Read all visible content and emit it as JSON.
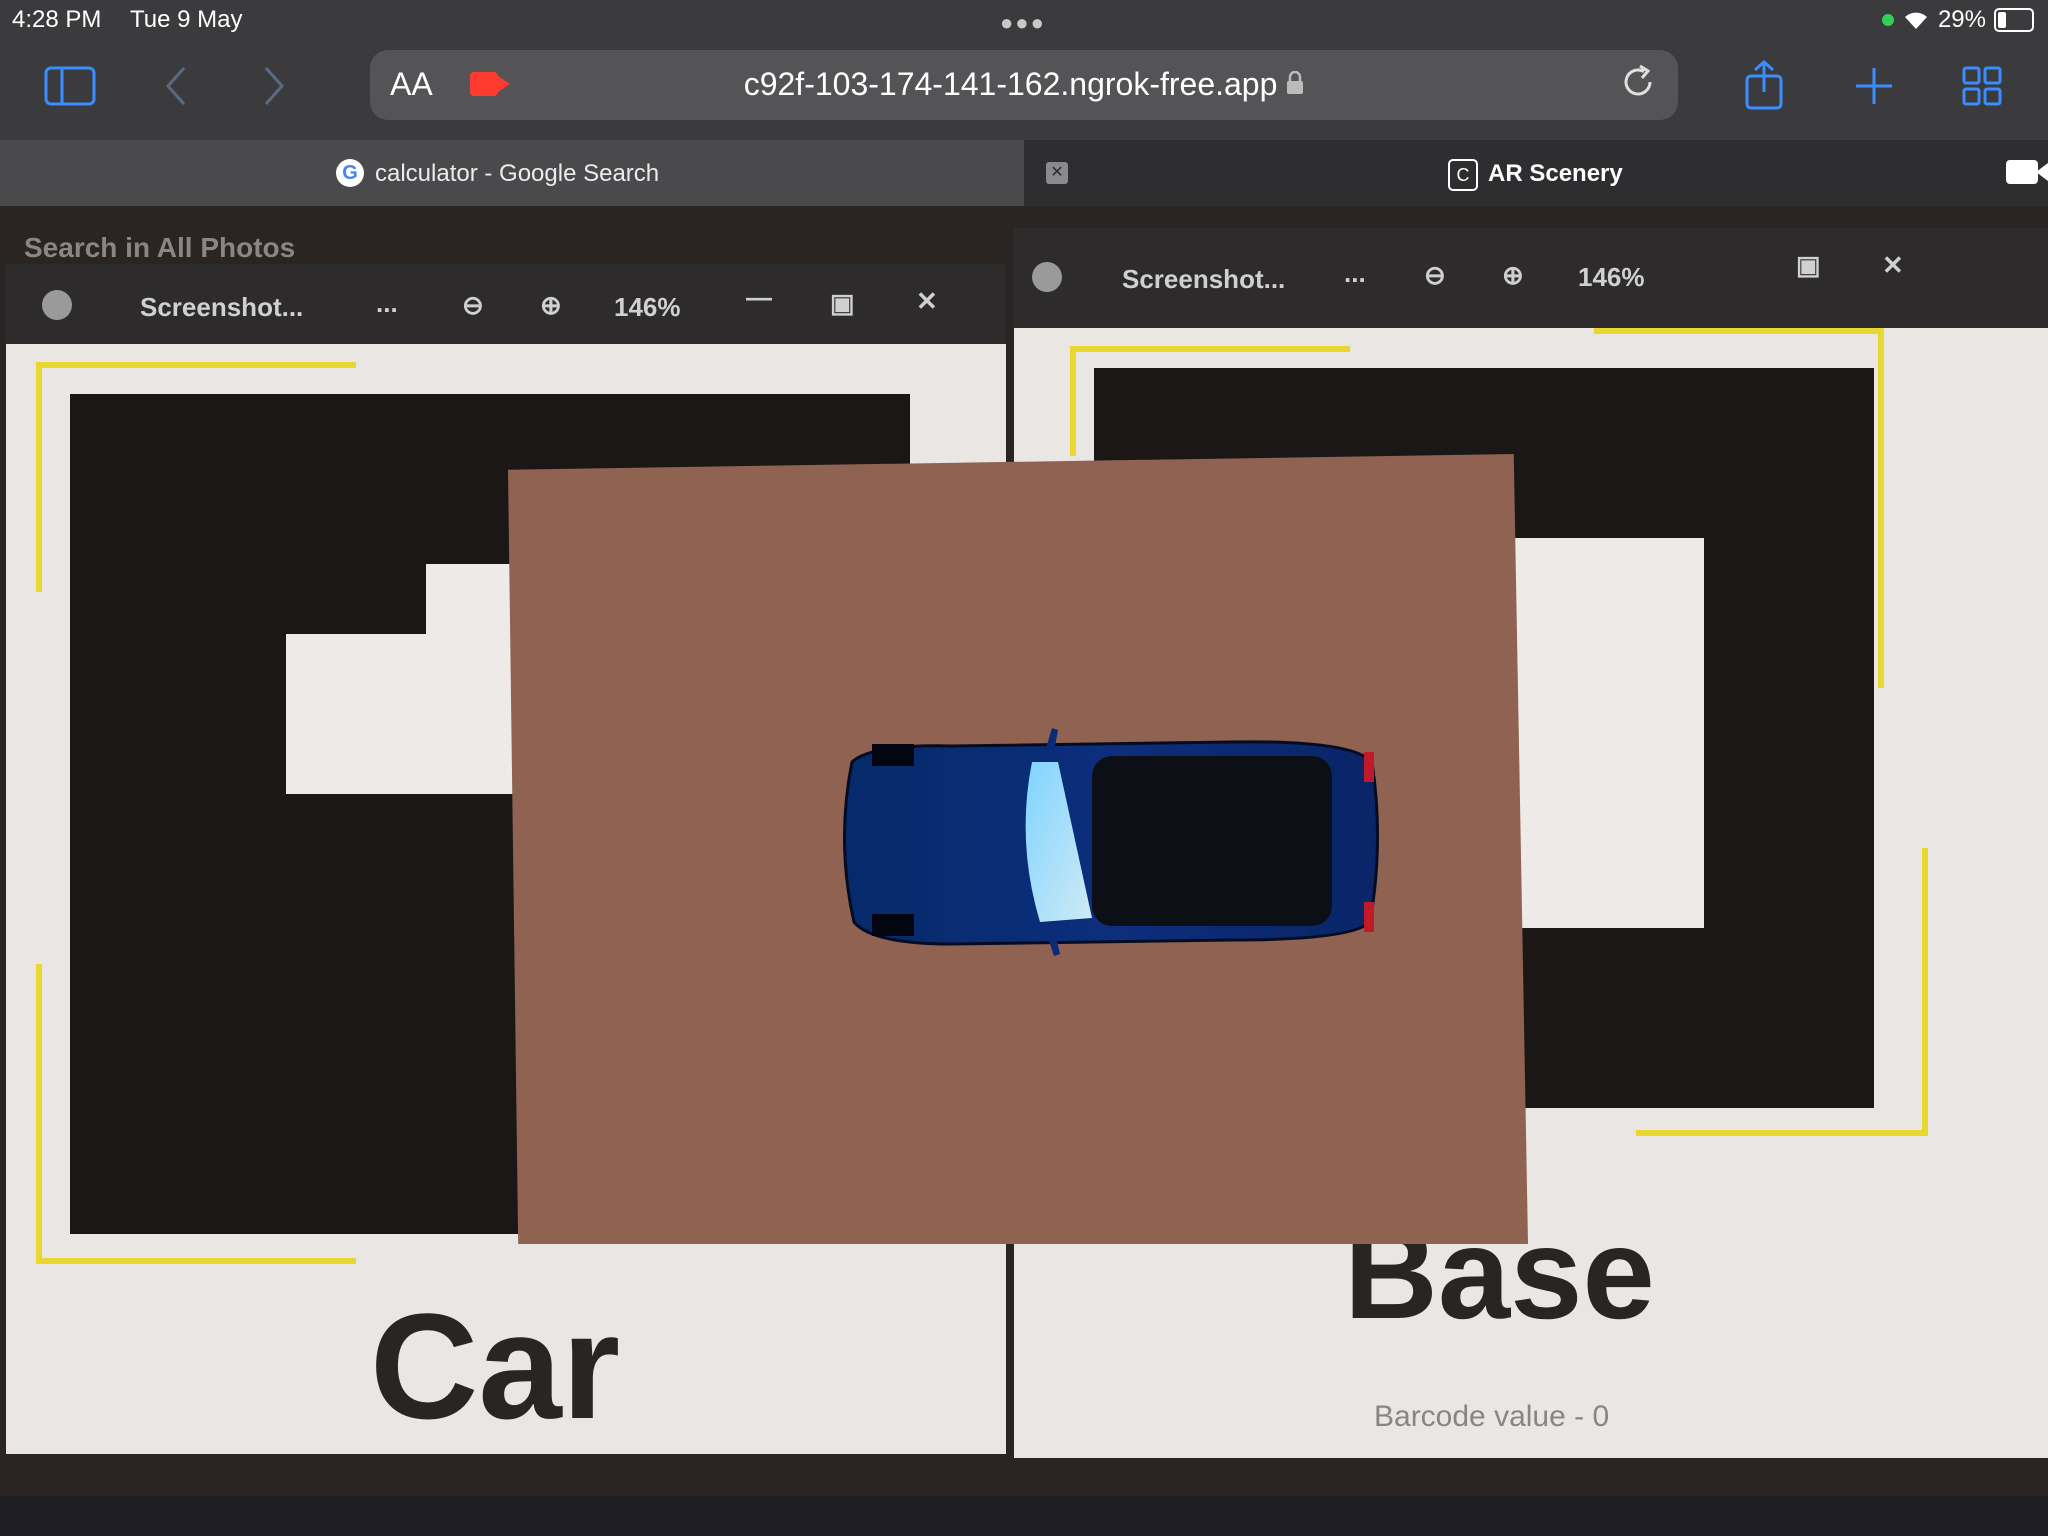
{
  "status": {
    "time": "4:28 PM",
    "date": "Tue 9 May",
    "battery": "29%",
    "battery_level": 0.29
  },
  "toolbar": {
    "text_size_label": "AA",
    "url": "c92f-103-174-141-162.ngrok-free.app",
    "icons": [
      "sidebar-icon",
      "back-icon",
      "forward-icon",
      "record-icon",
      "lock-icon",
      "reload-icon",
      "share-icon",
      "add-icon",
      "tabs-grid-icon"
    ]
  },
  "tabs": [
    {
      "title": "calculator - Google Search",
      "favicon": "G"
    },
    {
      "title": "AR Scenery",
      "favicon": "C"
    }
  ],
  "scene": {
    "search_label": "Search in All Photos",
    "left_window": {
      "title": "Screenshot...",
      "more": "...",
      "zoom": "146%",
      "label": "Car"
    },
    "right_window": {
      "title": "Screenshot...",
      "more": "...",
      "zoom": "146%",
      "label": "Base",
      "barcode": "Barcode value - 0"
    }
  },
  "colors": {
    "accent": "#3a8dff",
    "plane": "#8f6252",
    "car_body": "#0b2a78",
    "record": "#ff3b30"
  }
}
